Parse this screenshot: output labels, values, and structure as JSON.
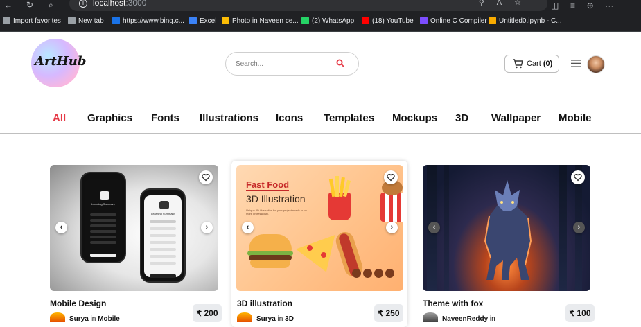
{
  "browser": {
    "url_host": "localhost",
    "url_port": ":3000",
    "bookmarks": [
      {
        "label": "Import favorites",
        "color": "#9aa0a6"
      },
      {
        "label": "New tab",
        "color": "#9aa0a6"
      },
      {
        "label": "https://www.bing.c...",
        "color": "#1a73e8"
      },
      {
        "label": "Excel",
        "color": "#3b82f6"
      },
      {
        "label": "Photo in Naveen ce...",
        "color": "#fbbc05"
      },
      {
        "label": "(2) WhatsApp",
        "color": "#25d366"
      },
      {
        "label": "(18) YouTube",
        "color": "#ff0000"
      },
      {
        "label": "Online C Compiler",
        "color": "#7c4dff"
      },
      {
        "label": "Untitled0.ipynb - C...",
        "color": "#f9ab00"
      }
    ]
  },
  "header": {
    "logo_text": "ArtHub",
    "search_placeholder": "Search...",
    "cart_label": "Cart",
    "cart_count": "(0)"
  },
  "categories": [
    {
      "label": "All",
      "active": true
    },
    {
      "label": "Graphics"
    },
    {
      "label": "Fonts"
    },
    {
      "label": "Illustrations"
    },
    {
      "label": "Icons"
    },
    {
      "label": "Templates"
    },
    {
      "label": "Mockups"
    },
    {
      "label": "3D"
    },
    {
      "label": "Wallpaper"
    },
    {
      "label": "Mobile"
    }
  ],
  "cards": [
    {
      "title": "Mobile Design",
      "author": "Surya",
      "in": "in",
      "category": "Mobile",
      "price": "₹ 200"
    },
    {
      "title": "3D illustration",
      "author": "Surya",
      "in": "in",
      "category": "3D",
      "price": "₹ 250",
      "image_title": "Fast Food",
      "image_subtitle": "3D Illustration",
      "image_desc": "Unique 3D illustration for your project needs to be more professional."
    },
    {
      "title": "Theme with fox",
      "author": "NaveenReddy",
      "in": "in",
      "category": "",
      "price": "₹ 100"
    }
  ],
  "phone_screen_title": "Learning Summary",
  "colors": {
    "accent": "#e63946",
    "search_icon": "#e63946"
  }
}
